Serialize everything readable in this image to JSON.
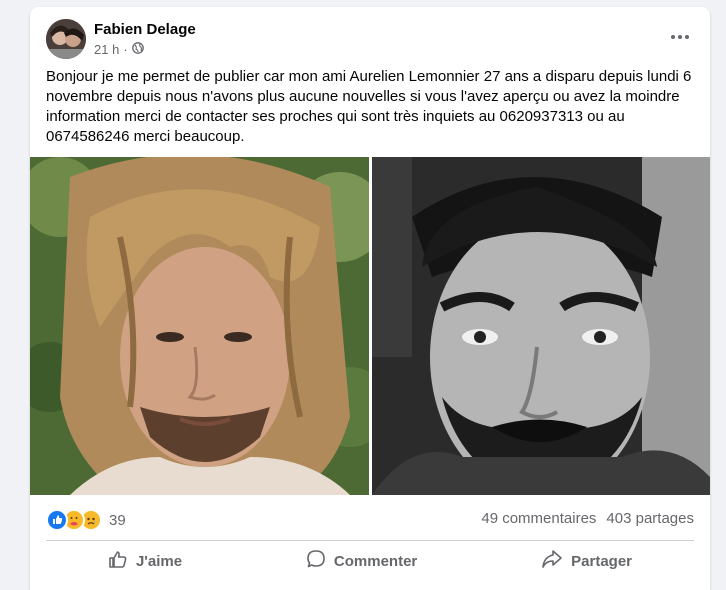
{
  "post": {
    "author": "Fabien Delage",
    "time": "21 h",
    "audience_icon": "globe-icon",
    "menu_icon": "more-options-icon",
    "text": "Bonjour je me permet de publier car mon ami Aurelien Lemonnier 27 ans  a disparu depuis lundi 6 novembre depuis nous n'avons plus aucune nouvelles si vous l'avez aperçu ou avez la moindre information merci de contacter ses proches qui sont très inquiets au 0620937313 ou au 0674586246 merci beaucoup.",
    "photos": [
      {
        "icon": "photo-long-hair-man",
        "tone": "color"
      },
      {
        "icon": "photo-bearded-man",
        "tone": "black-and-white"
      }
    ]
  },
  "stats": {
    "reaction_icons": [
      "like-icon",
      "care-icon",
      "sad-icon"
    ],
    "reaction_count": "39",
    "comments": "49 commentaires",
    "shares": "403 partages"
  },
  "actions": {
    "like": "J'aime",
    "comment": "Commenter",
    "share": "Partager"
  },
  "colors": {
    "background": "#f0f2f5",
    "card": "#ffffff",
    "secondary_text": "#65676b",
    "like_blue": "#1877f2",
    "reaction_yellow": "#f7b928"
  }
}
